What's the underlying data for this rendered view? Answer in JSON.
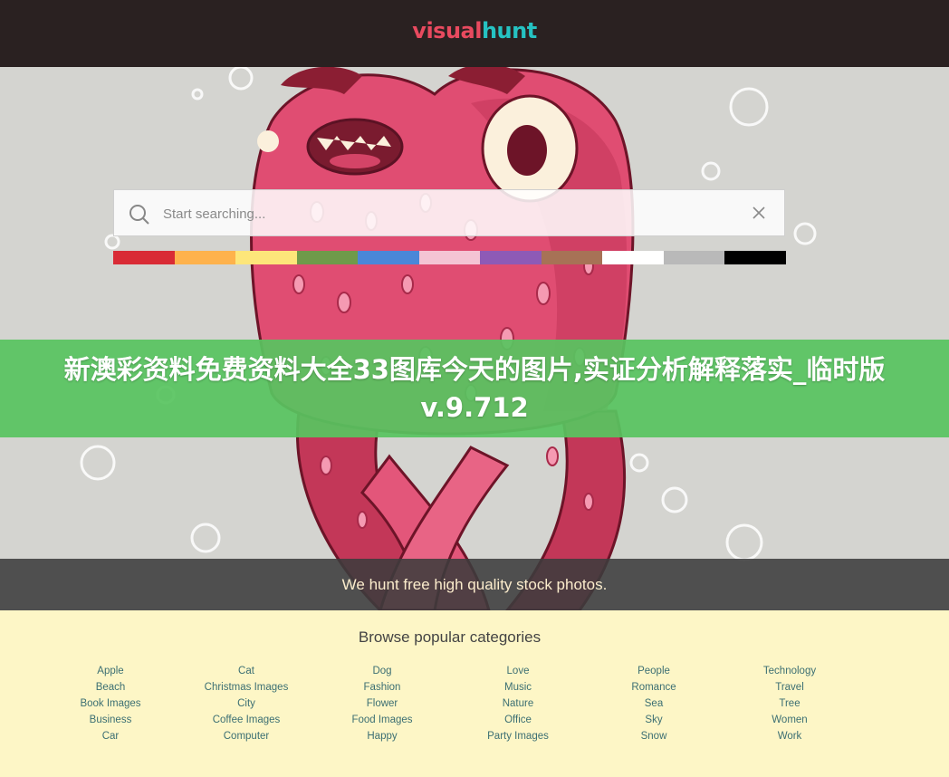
{
  "header": {
    "logo_part1": "visual",
    "logo_part2": "hunt"
  },
  "search": {
    "placeholder": "Start searching...",
    "search_icon": "magnifier-icon",
    "clear_icon": "close-icon"
  },
  "color_filters": [
    "#d92b35",
    "#feb24c",
    "#fde67a",
    "#6f9a4a",
    "#4a87d8",
    "#f4c4d4",
    "#8e5ab6",
    "#a77256",
    "#ffffff",
    "#b9b9b9",
    "#000000"
  ],
  "banner": {
    "title": "新澳彩资料免费资料大全33图库今天的图片,实证分析解释落实_临时版v.9.712"
  },
  "tagline": "We hunt free high quality stock photos.",
  "categories": {
    "heading": "Browse popular categories",
    "columns": [
      [
        "Apple",
        "Beach",
        "Book Images",
        "Business",
        "Car"
      ],
      [
        "Cat",
        "Christmas Images",
        "City",
        "Coffee Images",
        "Computer"
      ],
      [
        "Dog",
        "Fashion",
        "Flower",
        "Food Images",
        "Happy"
      ],
      [
        "Love",
        "Music",
        "Nature",
        "Office",
        "Party Images"
      ],
      [
        "People",
        "Romance",
        "Sea",
        "Sky",
        "Snow"
      ],
      [
        "Technology",
        "Travel",
        "Tree",
        "Women",
        "Work"
      ]
    ]
  }
}
